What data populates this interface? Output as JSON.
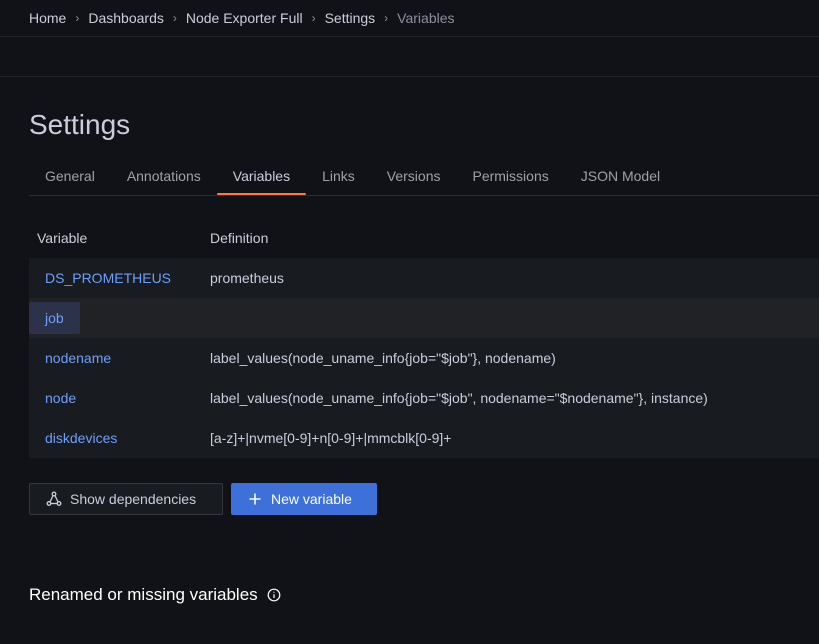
{
  "breadcrumb": [
    {
      "label": "Home"
    },
    {
      "label": "Dashboards"
    },
    {
      "label": "Node Exporter Full"
    },
    {
      "label": "Settings"
    },
    {
      "label": "Variables"
    }
  ],
  "page": {
    "title": "Settings"
  },
  "tabs": [
    {
      "label": "General"
    },
    {
      "label": "Annotations"
    },
    {
      "label": "Variables",
      "active": true
    },
    {
      "label": "Links"
    },
    {
      "label": "Versions"
    },
    {
      "label": "Permissions"
    },
    {
      "label": "JSON Model"
    }
  ],
  "table": {
    "headers": {
      "variable": "Variable",
      "definition": "Definition"
    },
    "rows": [
      {
        "variable": "DS_PROMETHEUS",
        "definition": "prometheus"
      },
      {
        "variable": "job",
        "definition": ""
      },
      {
        "variable": "nodename",
        "definition": "label_values(node_uname_info{job=\"$job\"}, nodename)"
      },
      {
        "variable": "node",
        "definition": "label_values(node_uname_info{job=\"$job\", nodename=\"$nodename\"}, instance)"
      },
      {
        "variable": "diskdevices",
        "definition": "[a-z]+|nvme[0-9]+n[0-9]+|mmcblk[0-9]+"
      }
    ]
  },
  "buttons": {
    "show_dependencies": "Show dependencies",
    "new_variable": "New variable"
  },
  "section": {
    "renamed_title": "Renamed or missing variables"
  },
  "colors": {
    "background": "#111217",
    "link": "#6e9fff",
    "primary": "#3d71d9",
    "active_tab": "#ff7a3d"
  },
  "icons": {
    "dependencies": "sitemap-icon",
    "plus": "plus-icon",
    "info": "info-circle-icon"
  }
}
